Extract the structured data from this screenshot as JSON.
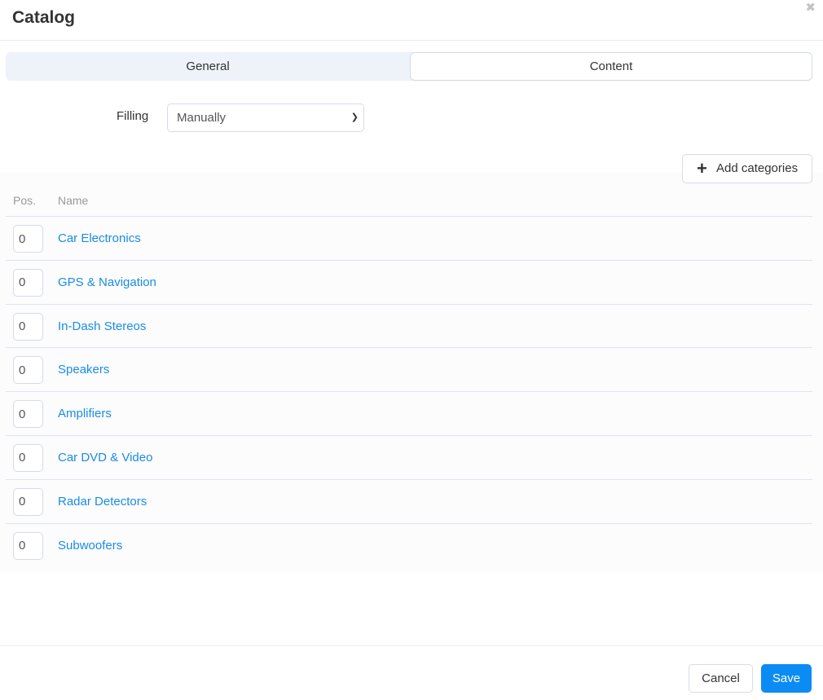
{
  "dialog": {
    "title": "Catalog",
    "close_icon": "close-icon"
  },
  "tabs": [
    {
      "label": "General",
      "active": false
    },
    {
      "label": "Content",
      "active": true
    }
  ],
  "filling": {
    "label": "Filling",
    "selected": "Manually"
  },
  "toolbar": {
    "add_categories_label": "Add categories",
    "add_icon": "plus-icon"
  },
  "table": {
    "columns": [
      "Pos.",
      "Name"
    ],
    "rows": [
      {
        "pos": "0",
        "name": "Car Electronics"
      },
      {
        "pos": "0",
        "name": "GPS & Navigation"
      },
      {
        "pos": "0",
        "name": "In-Dash Stereos"
      },
      {
        "pos": "0",
        "name": "Speakers"
      },
      {
        "pos": "0",
        "name": "Amplifiers"
      },
      {
        "pos": "0",
        "name": "Car DVD & Video"
      },
      {
        "pos": "0",
        "name": "Radar Detectors"
      },
      {
        "pos": "0",
        "name": "Subwoofers"
      }
    ]
  },
  "footer": {
    "cancel_label": "Cancel",
    "save_label": "Save"
  },
  "colors": {
    "accent": "#0b8cf5",
    "link": "#1a8ce6",
    "border": "#d5dbe8"
  }
}
